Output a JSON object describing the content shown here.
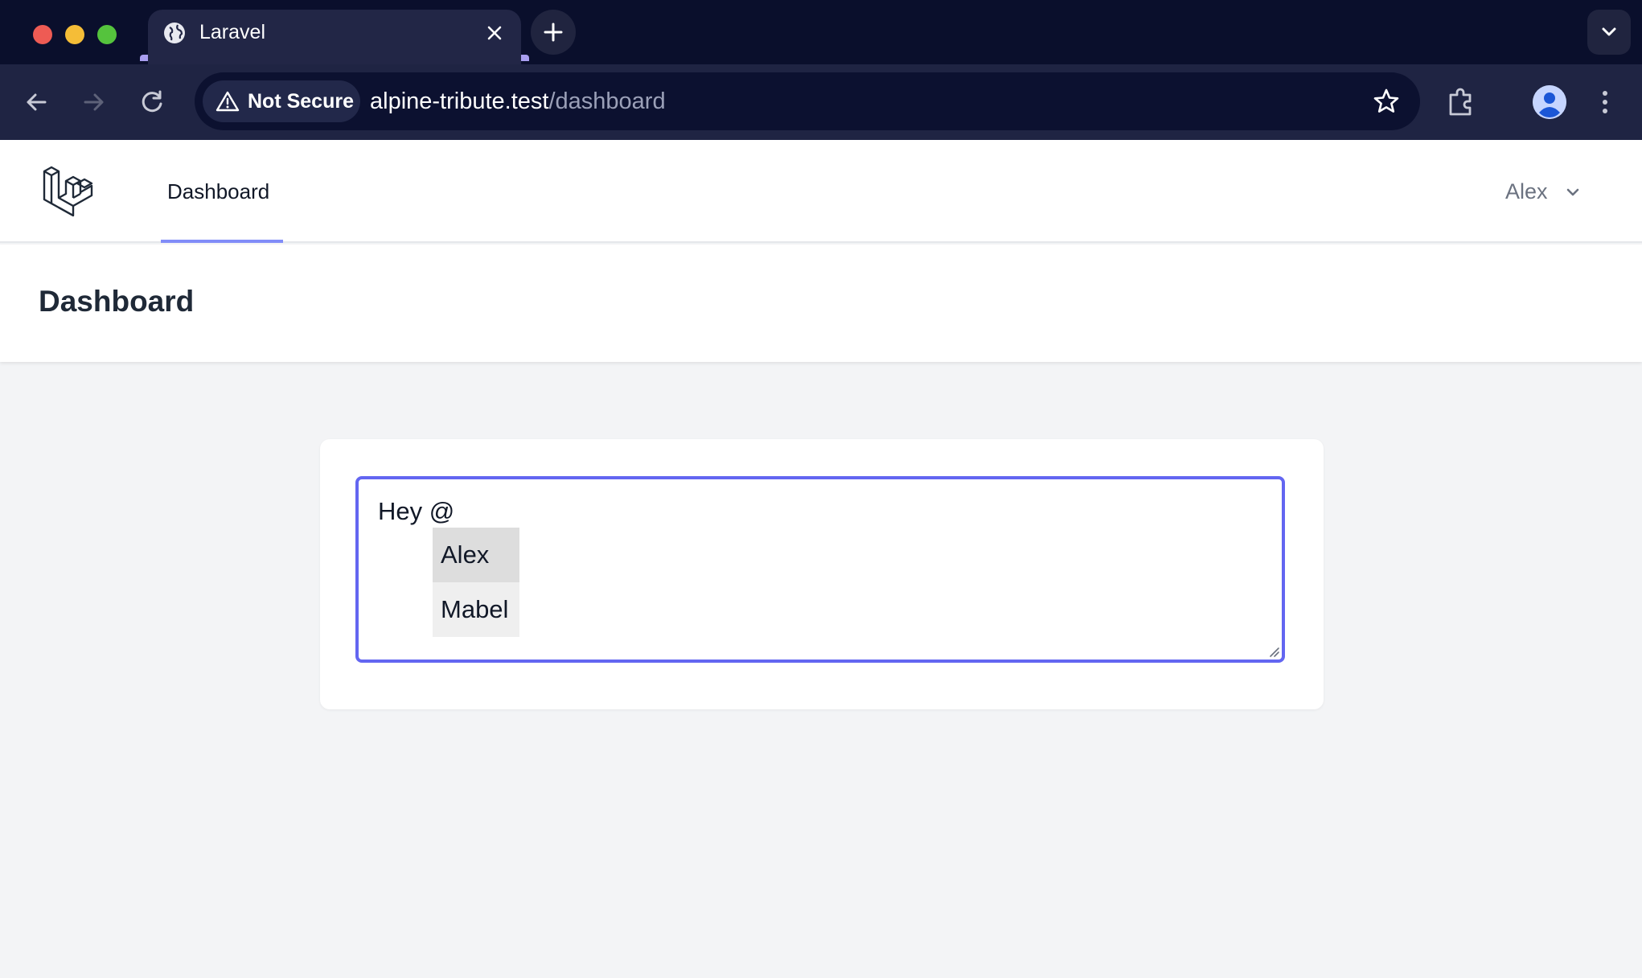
{
  "browser": {
    "tab": {
      "title": "Laravel"
    },
    "omnibox": {
      "security_label": "Not Secure",
      "url_host": "alpine-tribute.test",
      "url_path": "/dashboard"
    }
  },
  "app": {
    "nav": {
      "dashboard_link": "Dashboard",
      "user_name": "Alex"
    },
    "header": {
      "title": "Dashboard"
    },
    "editor": {
      "text": "Hey @",
      "mention_options": [
        {
          "label": "Alex",
          "highlighted": true
        },
        {
          "label": "Mabel",
          "highlighted": false
        }
      ]
    }
  },
  "colors": {
    "accent": "#6366f1",
    "nav_underline": "#818cf8",
    "tab_accent": "#a99ef0",
    "titlebar": "#0a0f2c",
    "toolbar": "#1f2443"
  }
}
